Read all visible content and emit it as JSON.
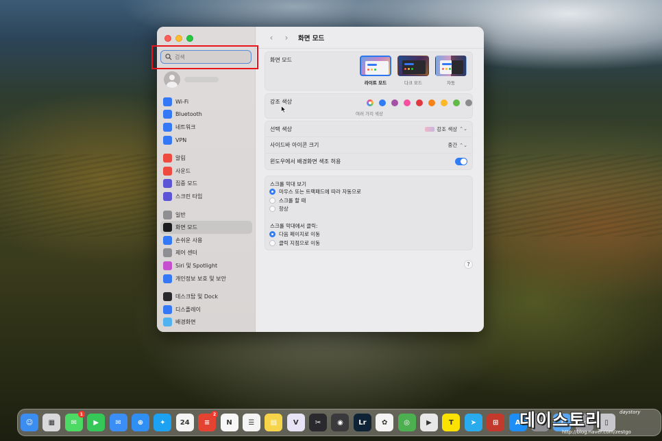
{
  "window": {
    "title": "화면 모드",
    "back_label": "‹",
    "forward_label": "›"
  },
  "search": {
    "placeholder": "검색"
  },
  "sidebar": {
    "groups": [
      [
        {
          "label": "Wi-Fi",
          "icon": "wifi-icon",
          "color": "#3478f6"
        },
        {
          "label": "Bluetooth",
          "icon": "bluetooth-icon",
          "color": "#3478f6"
        },
        {
          "label": "네트워크",
          "icon": "globe-icon",
          "color": "#3478f6"
        },
        {
          "label": "VPN",
          "icon": "vpn-globe-icon",
          "color": "#3478f6"
        }
      ],
      [
        {
          "label": "알림",
          "icon": "bell-icon",
          "color": "#ef4a40"
        },
        {
          "label": "사운드",
          "icon": "speaker-icon",
          "color": "#ef4a40"
        },
        {
          "label": "집중 모드",
          "icon": "moon-icon",
          "color": "#5b54d6"
        },
        {
          "label": "스크린 타임",
          "icon": "hourglass-icon",
          "color": "#5b54d6"
        }
      ],
      [
        {
          "label": "일반",
          "icon": "gear-icon",
          "color": "#8e8e93"
        },
        {
          "label": "화면 모드",
          "icon": "appearance-icon",
          "color": "#1c1c1e",
          "selected": true
        },
        {
          "label": "손쉬운 사용",
          "icon": "accessibility-icon",
          "color": "#3478f6"
        },
        {
          "label": "제어 센터",
          "icon": "control-center-icon",
          "color": "#8e8e93"
        },
        {
          "label": "Siri 및 Spotlight",
          "icon": "siri-icon",
          "color": "#c54fcf"
        },
        {
          "label": "개인정보 보호 및 보안",
          "icon": "hand-icon",
          "color": "#3478f6"
        }
      ],
      [
        {
          "label": "데스크탑 및 Dock",
          "icon": "dock-icon",
          "color": "#2a2a2e"
        },
        {
          "label": "디스플레이",
          "icon": "display-icon",
          "color": "#3478f6"
        },
        {
          "label": "배경화면",
          "icon": "wallpaper-icon",
          "color": "#4fb3f0"
        }
      ]
    ]
  },
  "appearance": {
    "label": "화면 모드",
    "options": [
      {
        "label": "라이트 모드",
        "kind": "light",
        "selected": true
      },
      {
        "label": "다크 모드",
        "kind": "dark"
      },
      {
        "label": "자동",
        "kind": "auto"
      }
    ]
  },
  "accent": {
    "label": "강조 색상",
    "multicolor_label": "여러 가지 색상",
    "colors": [
      "multicolor",
      "#2f7cf6",
      "#a550a7",
      "#f74f9e",
      "#e0383e",
      "#f7821b",
      "#fcb827",
      "#62ba46",
      "#8c8c8c"
    ]
  },
  "rows": {
    "highlight_label": "선택 색상",
    "highlight_value": "강조 색상",
    "sidebar_icon_label": "사이드바 아이콘 크기",
    "sidebar_icon_value": "중간",
    "tinting_label": "윈도우에서 배경화면 색조 허용",
    "tinting_on": true,
    "chevron": "⌃⌄"
  },
  "scroll": {
    "show_title": "스크롤 막대 보기",
    "show_options": [
      {
        "label": "마우스 또는 트랙패드에 따라 자동으로",
        "selected": true
      },
      {
        "label": "스크롤 할 때",
        "selected": false
      },
      {
        "label": "항상",
        "selected": false
      }
    ],
    "click_title": "스크롤 막대에서 클릭:",
    "click_options": [
      {
        "label": "다음 페이지로 이동",
        "selected": true
      },
      {
        "label": "클릭 지점으로 이동",
        "selected": false
      }
    ]
  },
  "help_label": "?",
  "dock": {
    "apps": [
      {
        "name": "finder",
        "color": "#3c8df0",
        "glyph": "☺"
      },
      {
        "name": "launchpad",
        "color": "#d9d9dc",
        "glyph": "▦"
      },
      {
        "name": "messages",
        "color": "#4cd964",
        "glyph": "✉",
        "badge": "1"
      },
      {
        "name": "facetime",
        "color": "#36c759",
        "glyph": "▶"
      },
      {
        "name": "mail",
        "color": "#3a8ef5",
        "glyph": "✉"
      },
      {
        "name": "safari",
        "color": "#2f8ff5",
        "glyph": "⊕"
      },
      {
        "name": "twitter",
        "color": "#1da1f2",
        "glyph": "✦"
      },
      {
        "name": "calendar",
        "color": "#f4f4f4",
        "glyph": "24"
      },
      {
        "name": "todoist",
        "color": "#e44332",
        "glyph": "≡",
        "badge": "2"
      },
      {
        "name": "notion",
        "color": "#f7f7f7",
        "glyph": "N"
      },
      {
        "name": "reminders",
        "color": "#f4f4f4",
        "glyph": "☰"
      },
      {
        "name": "notes",
        "color": "#f7d54a",
        "glyph": "▤"
      },
      {
        "name": "vivid",
        "color": "#e9e4f5",
        "glyph": "V"
      },
      {
        "name": "final-cut",
        "color": "#2a2a2e",
        "glyph": "✂"
      },
      {
        "name": "davinci",
        "color": "#3a3a3c",
        "glyph": "◉"
      },
      {
        "name": "lightroom",
        "color": "#0f2336",
        "glyph": "Lr"
      },
      {
        "name": "photos",
        "color": "#f4f4f4",
        "glyph": "✿"
      },
      {
        "name": "snapseed",
        "color": "#4caf50",
        "glyph": "◎"
      },
      {
        "name": "play",
        "color": "#e8e8e8",
        "glyph": "▶"
      },
      {
        "name": "kakaotalk",
        "color": "#fae100",
        "glyph": "T"
      },
      {
        "name": "telegram",
        "color": "#2aabee",
        "glyph": "➤"
      },
      {
        "name": "windows",
        "color": "#c33a2c",
        "glyph": "⊞"
      },
      {
        "name": "app-store",
        "color": "#1e8ef7",
        "glyph": "A"
      },
      {
        "name": "settings",
        "color": "#8e8e93",
        "glyph": "⚙"
      },
      {
        "name": "downloads",
        "color": "#5aa6f0",
        "glyph": "↓"
      },
      {
        "name": "folder",
        "color": "#9a9a9e",
        "glyph": "▭"
      },
      {
        "name": "trash",
        "color": "#c8c8cc",
        "glyph": "▯"
      }
    ]
  },
  "watermark": {
    "title": "데이스토리",
    "signature": "daystory",
    "url": "http://blog.naver.com/zestgo"
  }
}
